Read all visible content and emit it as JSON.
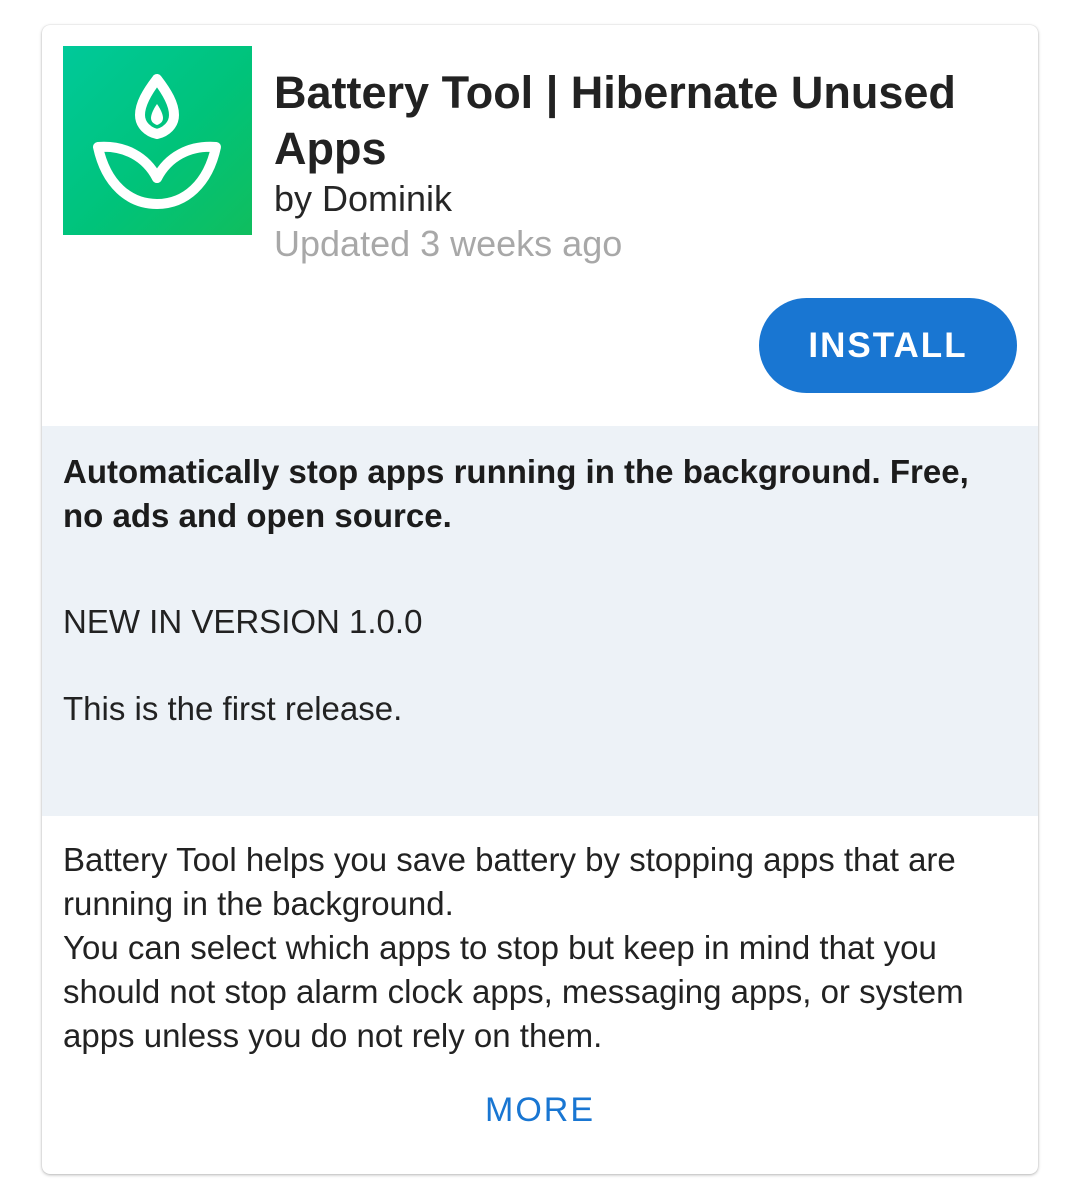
{
  "app": {
    "icon": "sprout-leaf-icon",
    "icon_colors": [
      "#00c99a",
      "#10be5e"
    ],
    "title": "Battery Tool | Hibernate Unused Apps",
    "author": "by Dominik",
    "updated": "Updated 3 weeks ago"
  },
  "actions": {
    "install_label": "INSTALL",
    "install_color": "#1976d2"
  },
  "whats_new": {
    "summary": "Automatically stop apps running in the background. Free, no ads and open source.",
    "version_heading": "NEW IN VERSION 1.0.0",
    "notes": "This is the first release."
  },
  "description": {
    "text": "Battery Tool helps you save battery by stopping apps that are running in the background.\nYou can select which apps to stop but keep in mind that you should not stop alarm clock apps, messaging apps, or system apps unless you do not rely on them.",
    "more_label": "MORE"
  }
}
